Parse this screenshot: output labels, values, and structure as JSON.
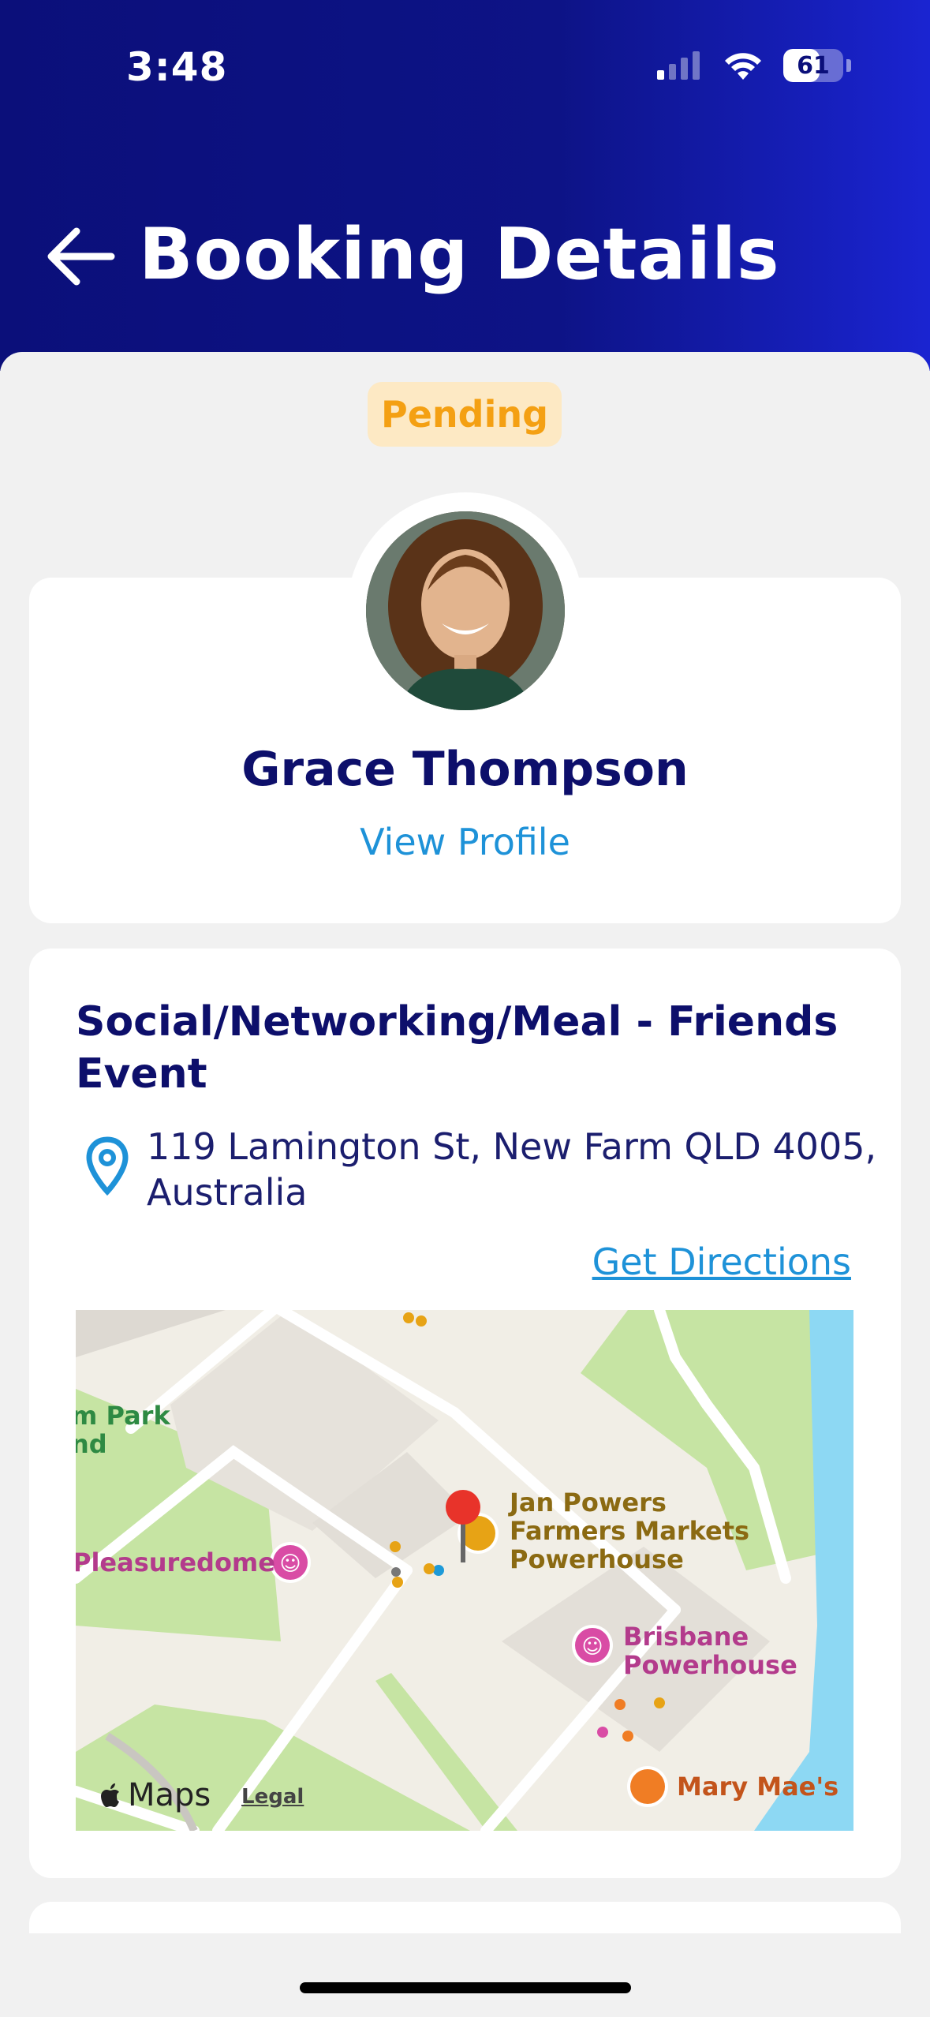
{
  "status_bar": {
    "time": "3:48",
    "battery": "61",
    "battery_level": 0.61
  },
  "header": {
    "title": "Booking Details"
  },
  "booking": {
    "status": "Pending"
  },
  "profile": {
    "name": "Grace Thompson",
    "link": "View Profile"
  },
  "event": {
    "title": "Social/Networking/Meal - Friends Event",
    "address": "119 Lamington St, New Farm QLD 4005, Australia",
    "directions": "Get Directions"
  },
  "map": {
    "brand": "Maps",
    "legal": "Legal",
    "labels": {
      "park": "m Park\nnd",
      "pleasuredome": "Pleasuredome",
      "jan_powers": "Jan Powers\nFarmers Markets\nPowerhouse",
      "brisbane_powerhouse": "Brisbane\nPowerhouse",
      "mary_maes": "Mary Mae's"
    }
  },
  "colors": {
    "header_start": "#0b0f7a",
    "header_end": "#1a24d1",
    "pending_text": "#f4a013",
    "pending_bg": "#fde9c4",
    "link": "#1e92d8",
    "heading": "#0d0f6b"
  }
}
